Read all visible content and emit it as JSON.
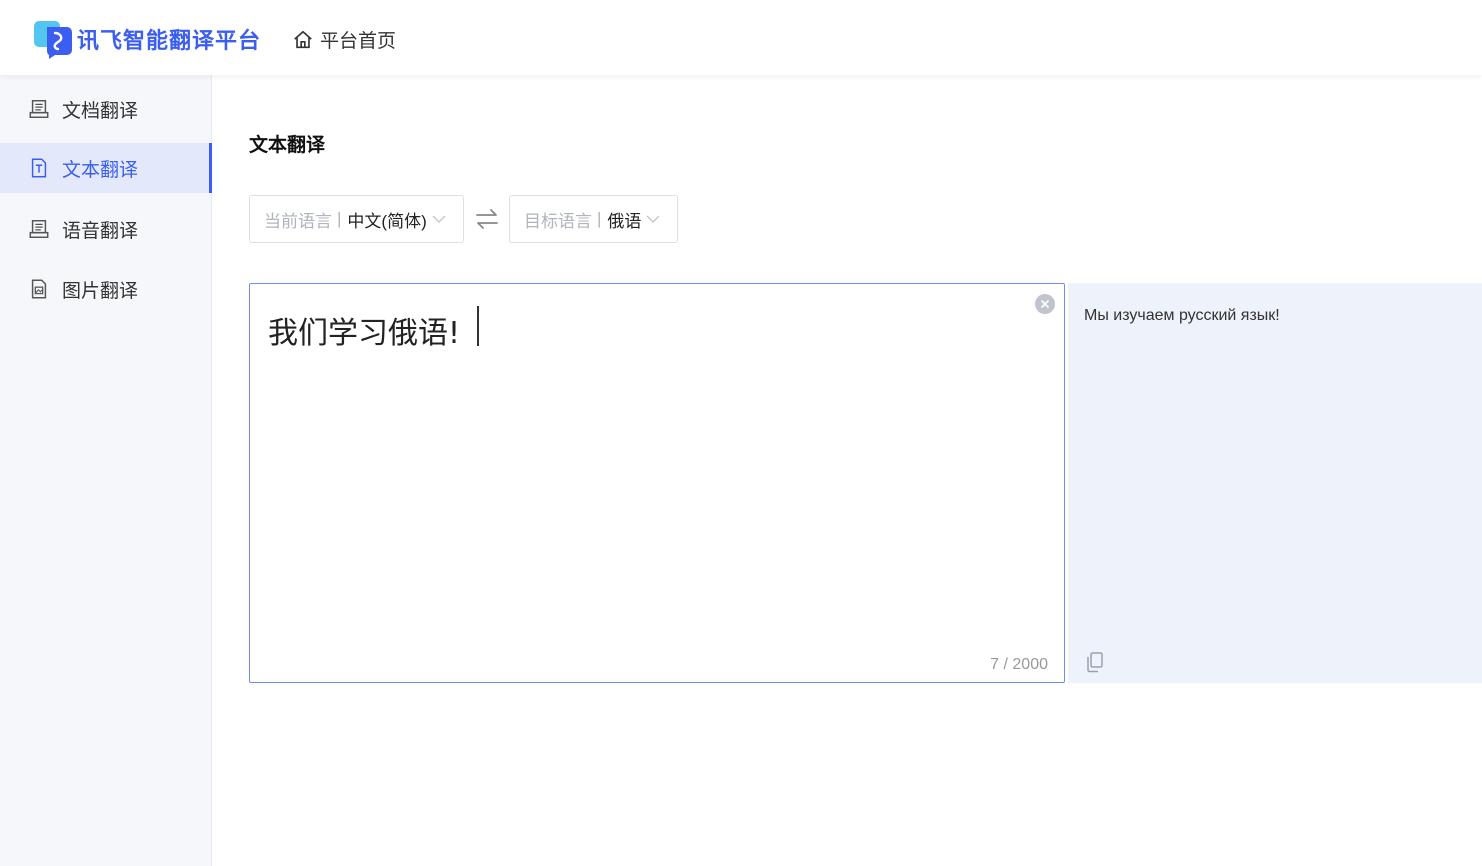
{
  "header": {
    "brand": "讯飞智能翻译平台",
    "home_label": "平台首页"
  },
  "sidebar": {
    "items": [
      {
        "label": "文档翻译",
        "icon": "document-icon"
      },
      {
        "label": "文本翻译",
        "icon": "text-doc-icon",
        "active": true
      },
      {
        "label": "语音翻译",
        "icon": "voice-icon"
      },
      {
        "label": "图片翻译",
        "icon": "image-icon"
      }
    ]
  },
  "main": {
    "title": "文本翻译",
    "source_lang": {
      "label": "当前语言",
      "value": "中文(简体)"
    },
    "target_lang": {
      "label": "目标语言",
      "value": "俄语"
    },
    "source_text": "我们学习俄语!",
    "counter": "7 / 2000",
    "translation": "Мы изучаем русский язык!"
  },
  "colors": {
    "accent": "#3c5ef0",
    "sidebar_bg": "#f5f7fb",
    "active_bg": "#e3e9fb",
    "result_bg": "#eef2fa"
  }
}
